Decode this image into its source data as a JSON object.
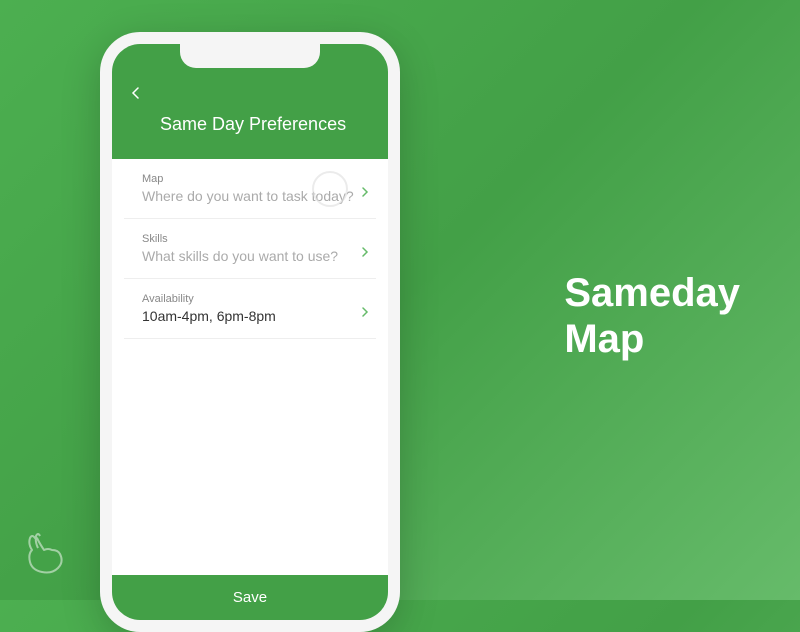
{
  "header": {
    "title": "Same Day Preferences"
  },
  "items": {
    "map": {
      "label": "Map",
      "placeholder": "Where do you want to task today?"
    },
    "skills": {
      "label": "Skills",
      "placeholder": "What skills do you want to use?"
    },
    "availability": {
      "label": "Availability",
      "value": "10am-4pm, 6pm-8pm"
    }
  },
  "buttons": {
    "save": "Save"
  },
  "side": {
    "line1": "Sameday",
    "line2": "Map"
  },
  "colors": {
    "accent": "#43A047",
    "chevron": "#66BB6A"
  }
}
